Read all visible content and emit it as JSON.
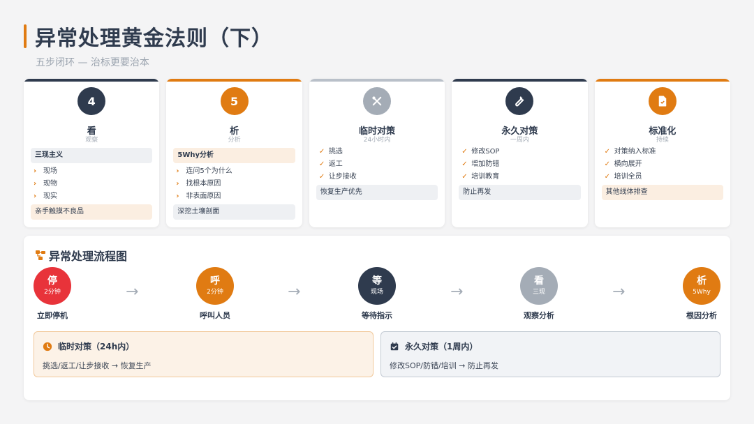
{
  "header": {
    "title": "异常处理黄金法则（下）",
    "subtitle": "五步闭环 — 治标更要治本"
  },
  "colors": {
    "accent": "#e07b12",
    "navy": "#2f3b4e",
    "grey": "#a4acb6",
    "red": "#e8333a"
  },
  "cards": [
    {
      "number": "4",
      "name": "看",
      "sub": "观察",
      "top_label": "三现主义",
      "items": [
        "现场",
        "现物",
        "现实"
      ],
      "bottom": "亲手触摸不良品"
    },
    {
      "number": "5",
      "name": "析",
      "sub": "分析",
      "top_label": "5Why分析",
      "items": [
        "连问5个为什么",
        "找根本原因",
        "非表面原因"
      ],
      "bottom": "深挖土壤剖面"
    },
    {
      "icon": "tools-icon",
      "name": "临时对策",
      "sub": "24小时内",
      "items": [
        "挑选",
        "返工",
        "让步接收"
      ],
      "bottom": "恢复生产优先"
    },
    {
      "icon": "wrench-icon",
      "name": "永久对策",
      "sub": "一周内",
      "items": [
        "修改SOP",
        "增加防错",
        "培训教育"
      ],
      "bottom": "防止再发"
    },
    {
      "icon": "document-icon",
      "name": "标准化",
      "sub": "持续",
      "items": [
        "对策纳入标准",
        "横向展开",
        "培训全员"
      ],
      "bottom": "其他线体排查"
    }
  ],
  "flow": {
    "title": "异常处理流程图",
    "steps": [
      {
        "big": "停",
        "small": "2分钟",
        "label": "立即停机"
      },
      {
        "big": "呼",
        "small": "2分钟",
        "label": "呼叫人员"
      },
      {
        "big": "等",
        "small": "现场",
        "label": "等待指示"
      },
      {
        "big": "看",
        "small": "三现",
        "label": "观察分析"
      },
      {
        "big": "析",
        "small": "5Why",
        "label": "根因分析"
      }
    ],
    "arrow": "→",
    "temp": {
      "title": "临时对策（24h内）",
      "text": "挑选/返工/让步接收 → 恢复生产"
    },
    "perm": {
      "title": "永久对策（1周内）",
      "text": "修改SOP/防错/培训 → 防止再发"
    }
  }
}
